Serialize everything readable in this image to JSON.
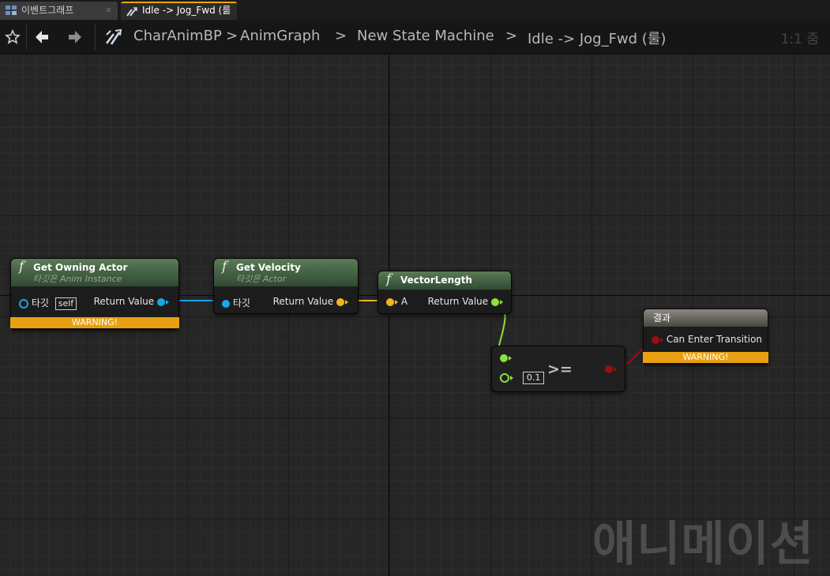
{
  "tabs": [
    {
      "label": "이벤트그래프",
      "close": "×"
    },
    {
      "label": "Idle -> Jog_Fwd (룰",
      "close": "×"
    }
  ],
  "breadcrumb": {
    "items": [
      "CharAnimBP",
      "AnimGraph",
      "New State Machine",
      "Idle -> Jog_Fwd (룰)"
    ],
    "separator": ">"
  },
  "zoom": "1:1 줌",
  "nodes": {
    "get_owning_actor": {
      "title": "Get Owning Actor",
      "subtitle": "타깃은 Anim Instance",
      "in_pin": "타깃",
      "in_default": "self",
      "out_pin": "Return Value",
      "warning": "WARNING!"
    },
    "get_velocity": {
      "title": "Get Velocity",
      "subtitle": "타깃은 Actor",
      "in_pin": "타깃",
      "out_pin": "Return Value"
    },
    "vector_length": {
      "title": "VectorLength",
      "in_pin": "A",
      "out_pin": "Return Value"
    },
    "compare": {
      "operator": ">=",
      "b_value": "0.1"
    },
    "result": {
      "title": "결과",
      "in_pin": "Can Enter Transition",
      "warning": "WARNING!"
    }
  },
  "colors": {
    "object_pin": "#1aa6e8",
    "vector_pin": "#f2b61d",
    "float_pin": "#8ee03a",
    "bool_pin": "#9a0f0f",
    "warning": "#e8a012",
    "tab_accent": "#f0a400"
  },
  "icons": [
    "graph-icon",
    "transition-icon",
    "star-icon",
    "back-arrow-icon",
    "forward-arrow-icon",
    "function-icon"
  ],
  "watermark": "애니메이션"
}
